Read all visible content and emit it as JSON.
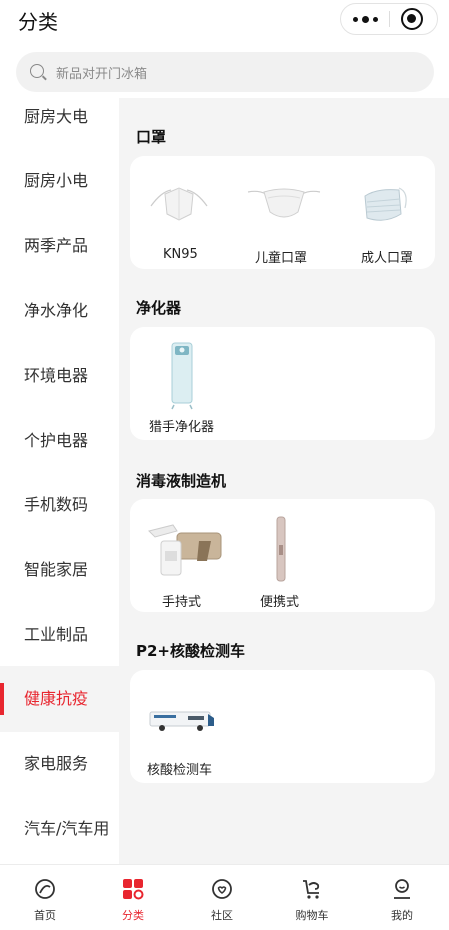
{
  "header": {
    "title": "分类"
  },
  "search": {
    "placeholder": "新品对开门冰箱"
  },
  "sidebar": {
    "items": [
      {
        "label": "厨房大电"
      },
      {
        "label": "厨房小电"
      },
      {
        "label": "两季产品"
      },
      {
        "label": "净水净化"
      },
      {
        "label": "环境电器"
      },
      {
        "label": "个护电器"
      },
      {
        "label": "手机数码"
      },
      {
        "label": "智能家居"
      },
      {
        "label": "工业制品"
      },
      {
        "label": "健康抗疫",
        "active": true
      },
      {
        "label": "家电服务"
      },
      {
        "label": "汽车/汽车用"
      }
    ]
  },
  "sections": [
    {
      "title": "口罩",
      "products": [
        {
          "name": "KN95"
        },
        {
          "name": "儿童口罩"
        },
        {
          "name": "成人口罩"
        }
      ]
    },
    {
      "title": "净化器",
      "products": [
        {
          "name": "猎手净化器"
        }
      ]
    },
    {
      "title": "消毒液制造机",
      "products": [
        {
          "name": "手持式"
        },
        {
          "name": "便携式"
        }
      ]
    },
    {
      "title": "P2+核酸检测车",
      "products": [
        {
          "name": "核酸检测车"
        }
      ]
    }
  ],
  "tabbar": {
    "items": [
      {
        "label": "首页",
        "icon": "home-icon"
      },
      {
        "label": "分类",
        "icon": "category-icon",
        "active": true
      },
      {
        "label": "社区",
        "icon": "community-icon"
      },
      {
        "label": "购物车",
        "icon": "cart-icon"
      },
      {
        "label": "我的",
        "icon": "profile-icon"
      }
    ]
  },
  "colors": {
    "accent": "#e8262f",
    "panel_bg": "#f4f4f4",
    "search_bg": "#f1f1f1"
  }
}
